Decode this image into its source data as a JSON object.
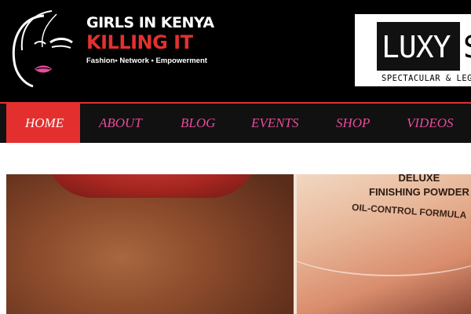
{
  "header": {
    "logo": {
      "line1": "GIRLS IN KENYA",
      "line2": "KILLING IT",
      "tagline": "Fashion• Network • Empowerment"
    },
    "ad": {
      "brand": "LUXY",
      "brand_cut_letter": "S",
      "subtitle": "SPECTACULAR & LEG"
    }
  },
  "nav": {
    "items": [
      {
        "label": "HOME",
        "active": true
      },
      {
        "label": "ABOUT",
        "active": false
      },
      {
        "label": "BLOG",
        "active": false
      },
      {
        "label": "EVENTS",
        "active": false
      },
      {
        "label": "SHOP",
        "active": false
      },
      {
        "label": "VIDEOS",
        "active": false
      }
    ]
  },
  "content": {
    "product_line1": "DELUXE",
    "product_line2": "FINISHING POWDER",
    "product_line3": "OIL-CONTROL FORMULA"
  },
  "colors": {
    "header_bg": "#000000",
    "brand_red": "#e3302f",
    "nav_bg": "#111111",
    "nav_text": "#e84b9b",
    "active_text": "#ffffff"
  },
  "icons": {
    "logo_mark": "woman-face-silhouette-icon"
  }
}
